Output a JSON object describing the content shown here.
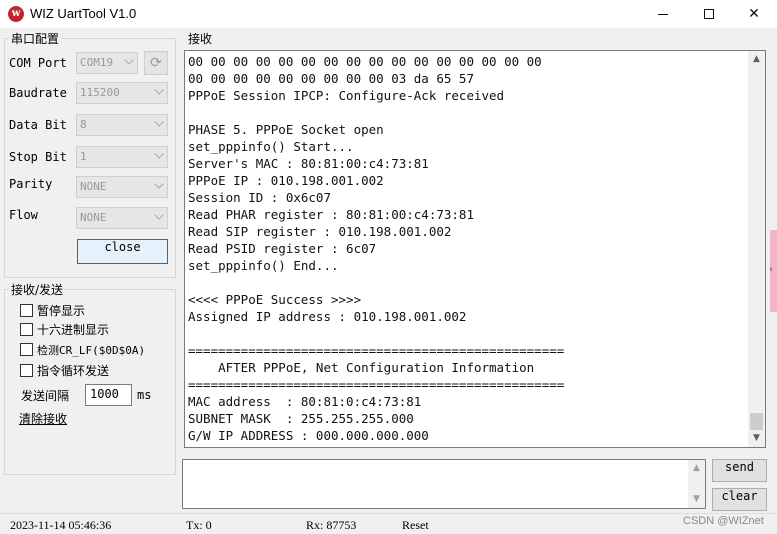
{
  "window": {
    "title": "WIZ UartTool V1.0",
    "icon": "wiz-logo-icon",
    "minimize_icon": "minimize-icon",
    "maximize_icon": "maximize-icon",
    "close_icon": "close-icon"
  },
  "serial": {
    "group_title": "串口配置",
    "com_port": {
      "label": "COM Port",
      "value": "COM19"
    },
    "baudrate": {
      "label": "Baudrate",
      "value": "115200"
    },
    "data_bit": {
      "label": "Data Bit",
      "value": "8"
    },
    "stop_bit": {
      "label": "Stop Bit",
      "value": "1"
    },
    "parity": {
      "label": "Parity",
      "value": "NONE"
    },
    "flow": {
      "label": "Flow",
      "value": "NONE"
    },
    "close_button": "close"
  },
  "trx": {
    "group_title": "接收/发送",
    "pause_display": "暂停显示",
    "hex_display": "十六进制显示",
    "detect_crlf": "检测CR_LF($0D$0A)",
    "loop_send": "指令循环发送",
    "interval_label": "发送间隔",
    "interval_value": "1000",
    "interval_unit": "ms",
    "clear_receive": "清除接收"
  },
  "receive": {
    "group_title": "接收",
    "lines": [
      "00 00 00 00 00 00 00 00 00 00 00 00 00 00 00 00",
      "00 00 00 00 00 00 00 00 00 03 da 65 57",
      "PPPoE Session IPCP: Configure-Ack received",
      "",
      "PHASE 5. PPPoE Socket open",
      "set_pppinfo() Start...",
      "Server's MAC : 80:81:00:c4:73:81",
      "PPPoE IP : 010.198.001.002",
      "Session ID : 0x6c07",
      "Read PHAR register : 80:81:00:c4:73:81",
      "Read SIP register : 010.198.001.002",
      "Read PSID register : 6c07",
      "set_pppinfo() End...",
      "",
      "<<<< PPPoE Success >>>>",
      "Assigned IP address : 010.198.001.002",
      "",
      "==================================================",
      "    AFTER PPPoE, Net Configuration Information",
      "==================================================",
      "MAC address  : 80:81:0:c4:73:81",
      "SUBNET MASK  : 255.255.255.000",
      "G/W IP ADDRESS : 000.000.000.000"
    ]
  },
  "send": {
    "input_value": "",
    "send_button": "send",
    "clear_button": "clear"
  },
  "status": {
    "datetime": "2023-11-14 05:46:36",
    "tx": "Tx: 0",
    "rx": "Rx: 87753",
    "reset": "Reset",
    "watermark": "CSDN @WIZnet"
  },
  "colors": {
    "accent": "#0078d7",
    "side_tab": "#f4b6c6"
  }
}
